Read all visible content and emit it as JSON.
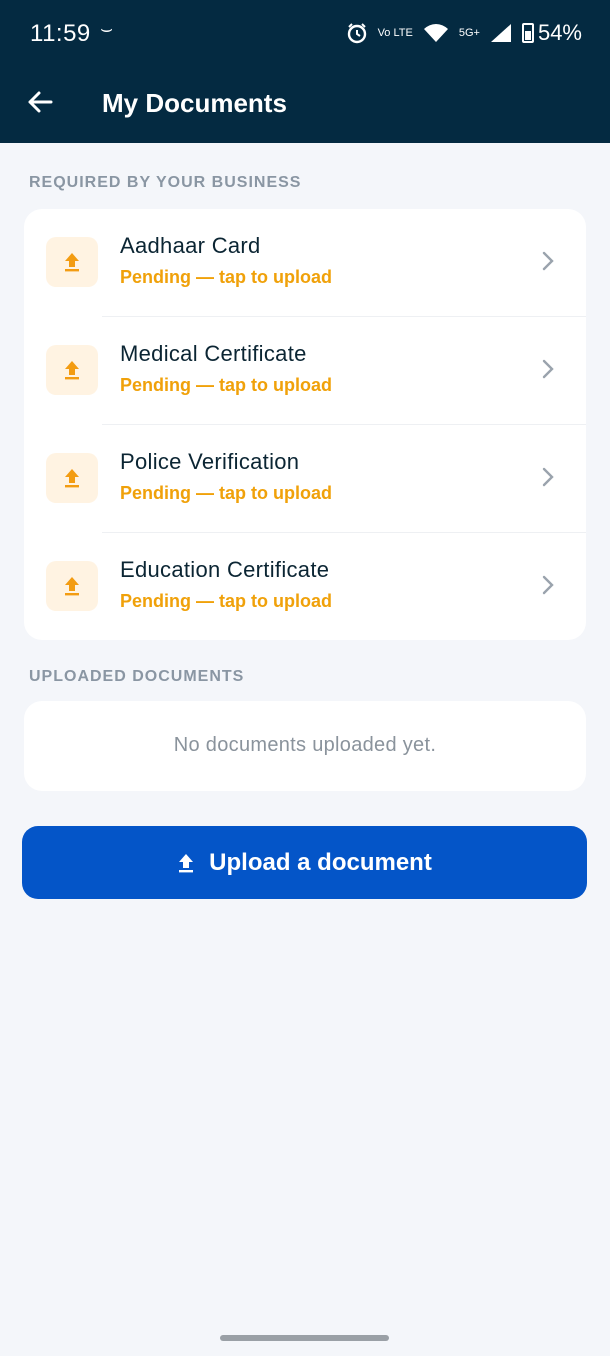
{
  "status_bar": {
    "time": "11:59",
    "time_extra": "⌣",
    "volte": "Vo LTE",
    "network": "5G+",
    "battery": "54%"
  },
  "header": {
    "title": "My Documents"
  },
  "required_section": {
    "label": "REQUIRED BY YOUR BUSINESS",
    "items": [
      {
        "name": "Aadhaar Card",
        "status": "Pending — tap to upload"
      },
      {
        "name": "Medical Certificate",
        "status": "Pending — tap to upload"
      },
      {
        "name": "Police Verification",
        "status": "Pending — tap to upload"
      },
      {
        "name": "Education Certificate",
        "status": "Pending — tap to upload"
      }
    ]
  },
  "uploaded_section": {
    "label": "UPLOADED DOCUMENTS",
    "empty_text": "No documents uploaded yet."
  },
  "upload_button": {
    "label": "Upload a document"
  },
  "colors": {
    "header_bg": "#042a41",
    "accent_orange": "#f0a10a",
    "primary_blue": "#0455c8"
  }
}
